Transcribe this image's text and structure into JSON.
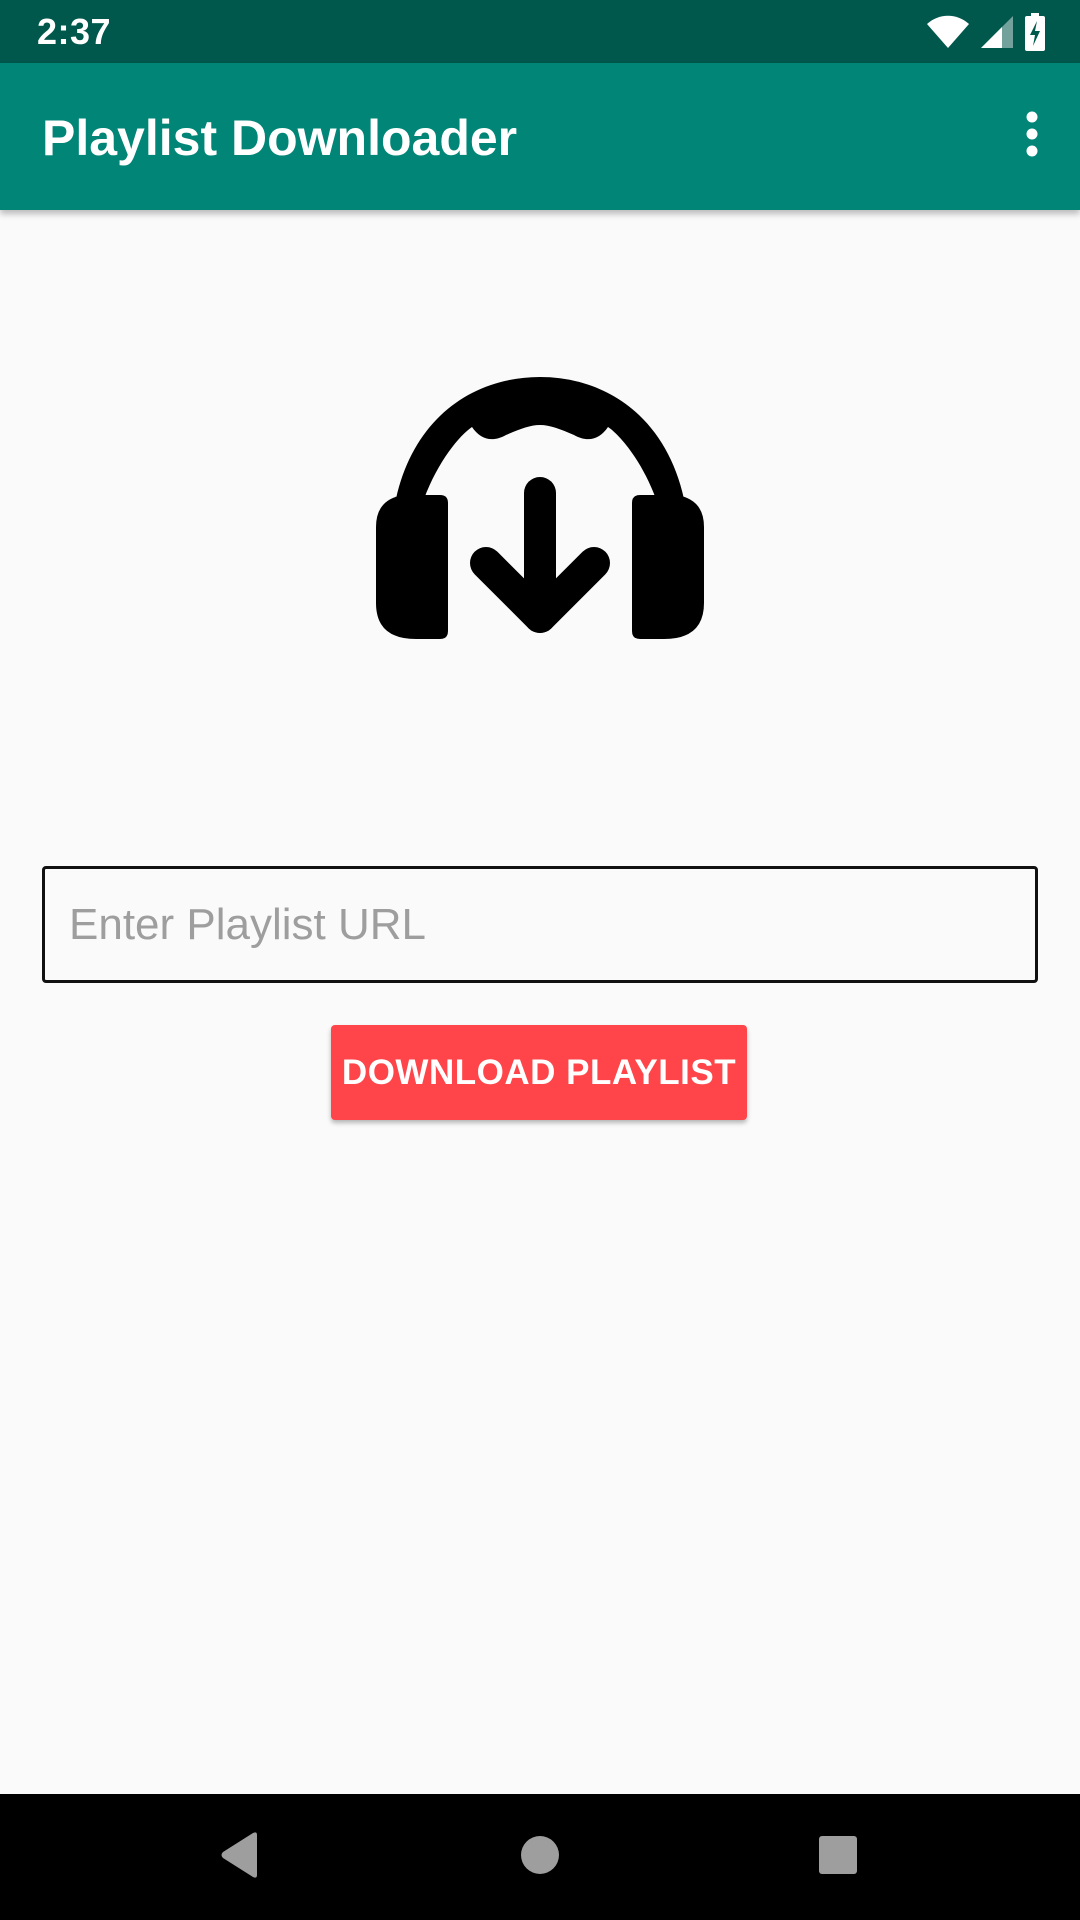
{
  "status_bar": {
    "time": "2:37",
    "icons": [
      "wifi-icon",
      "cellular-signal-icon",
      "battery-charging-icon"
    ],
    "background_color": "#00574b"
  },
  "app_bar": {
    "title": "Playlist Downloader",
    "menu_icon": "more-vert-icon",
    "background_color": "#008577"
  },
  "main": {
    "logo_icon": "headphones-download-icon",
    "url_input": {
      "placeholder": "Enter Playlist URL",
      "value": ""
    },
    "download_button": {
      "label": "DOWNLOAD PLAYLIST",
      "color": "#ff4549"
    }
  },
  "nav_bar": {
    "buttons": [
      "back-icon",
      "home-icon",
      "recents-icon"
    ]
  }
}
